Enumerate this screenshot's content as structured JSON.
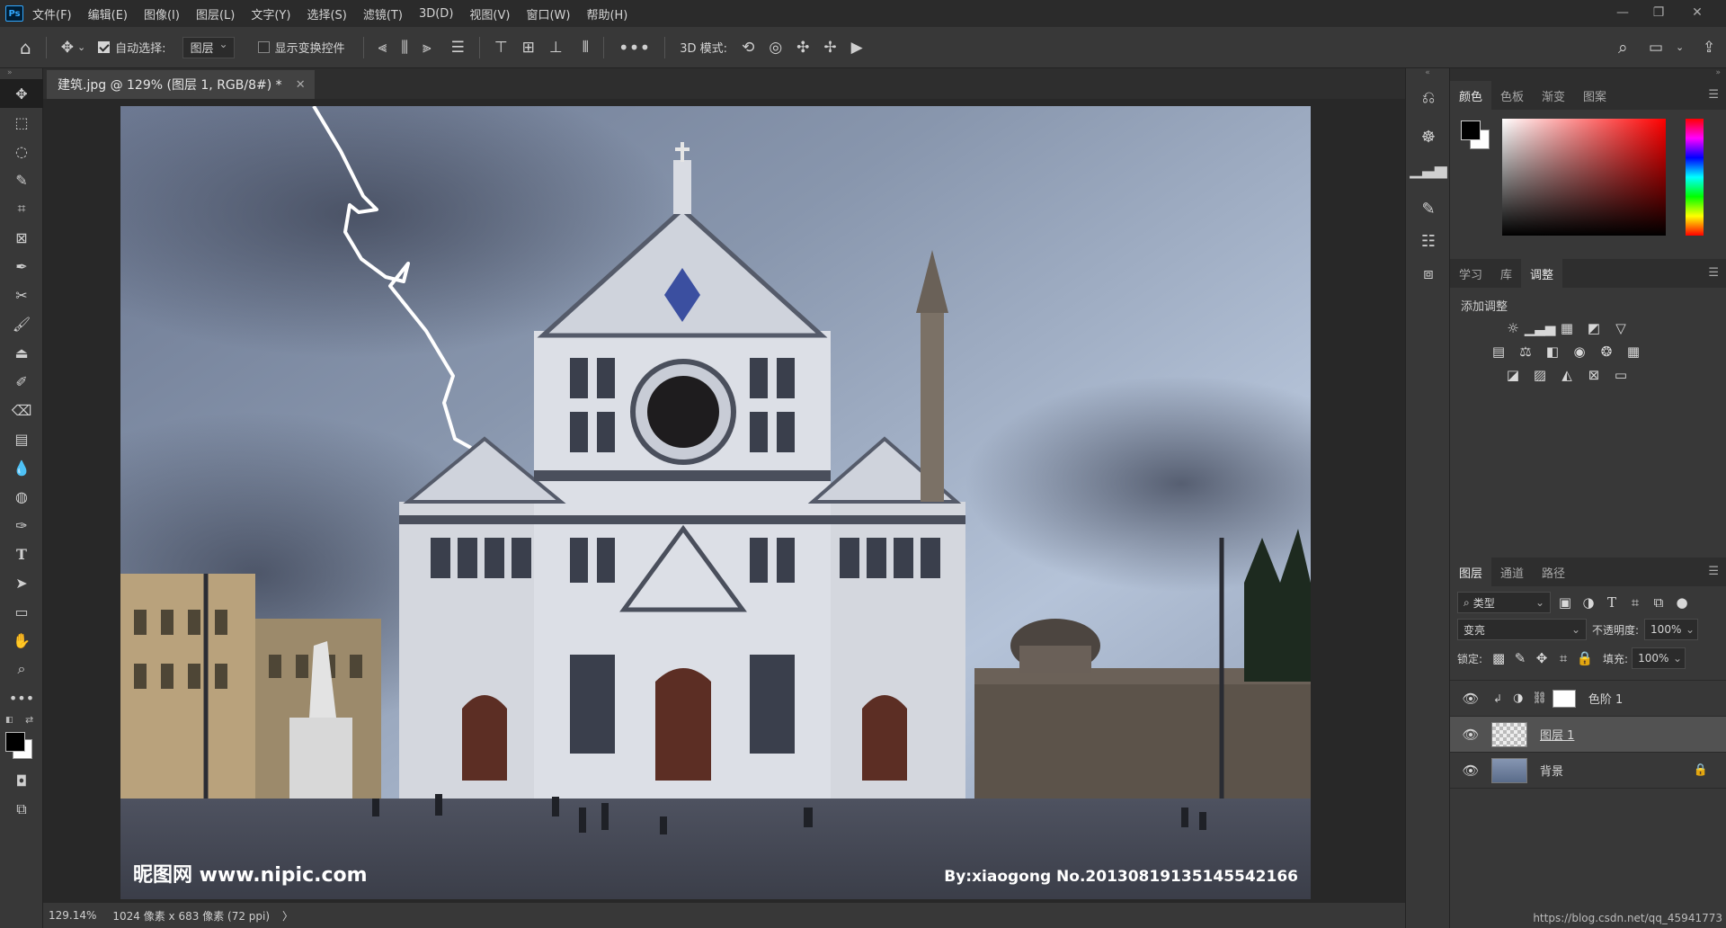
{
  "app": {
    "logo": "Ps"
  },
  "menubar": {
    "items": [
      "文件(F)",
      "编辑(E)",
      "图像(I)",
      "图层(L)",
      "文字(Y)",
      "选择(S)",
      "滤镜(T)",
      "3D(D)",
      "视图(V)",
      "窗口(W)",
      "帮助(H)"
    ]
  },
  "options": {
    "auto_select_label": "自动选择:",
    "auto_select_value": "图层",
    "show_transform_label": "显示变换控件",
    "mode_3d_label": "3D 模式:"
  },
  "document": {
    "tab_title": "建筑.jpg @ 129% (图层 1, RGB/8#) *",
    "watermark_left": "昵图网 www.nipic.com",
    "watermark_right": "By:xiaogong  No.20130819135145542166"
  },
  "status": {
    "zoom": "129.14%",
    "doc_info": "1024 像素 x 683 像素 (72 ppi)",
    "arrow": "〉"
  },
  "color_panel": {
    "tabs": [
      "颜色",
      "色板",
      "渐变",
      "图案"
    ],
    "active_tab": 0,
    "foreground": "#000000",
    "background": "#ffffff"
  },
  "adjust_panel": {
    "tabs": [
      "学习",
      "库",
      "调整"
    ],
    "active_tab": 2,
    "title": "添加调整"
  },
  "layers_panel": {
    "tabs": [
      "图层",
      "通道",
      "路径"
    ],
    "active_tab": 0,
    "filter_label": "类型",
    "blend_mode": "变亮",
    "opacity_label": "不透明度:",
    "opacity_value": "100%",
    "lock_label": "锁定:",
    "fill_label": "填充:",
    "fill_value": "100%",
    "layers": [
      {
        "name": "色阶 1",
        "type": "adjustment"
      },
      {
        "name": "图层 1",
        "type": "pixel",
        "selected": true
      },
      {
        "name": "背景",
        "type": "background",
        "locked": true
      }
    ]
  },
  "footer_url": "https://blog.csdn.net/qq_45941773",
  "colors": {
    "accent": "#31a8ff",
    "sky_top": "#a9b8cf",
    "sky_bottom": "#5f6d85"
  }
}
